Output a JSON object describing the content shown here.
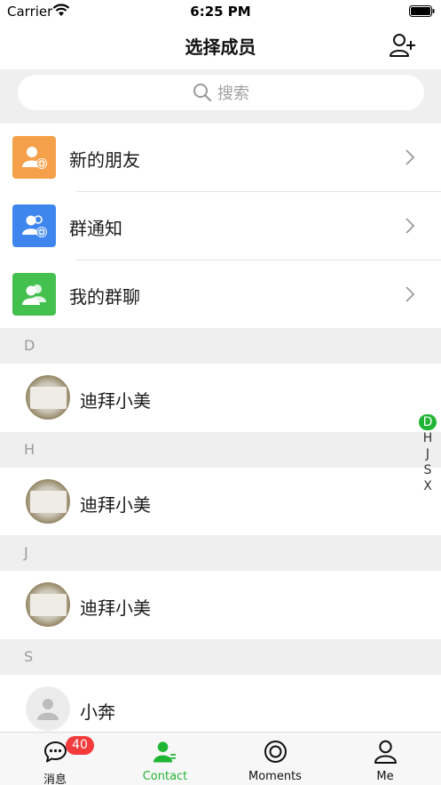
{
  "status_bar": {
    "carrier": "Carrier",
    "time": "6:25 PM"
  },
  "nav": {
    "title": "选择成员",
    "add_icon": "add-user-icon"
  },
  "search": {
    "placeholder": "搜索"
  },
  "entries": [
    {
      "label": "新的朋友",
      "icon": "new-friend-icon",
      "color": "#f5a04a"
    },
    {
      "label": "群通知",
      "icon": "group-notice-icon",
      "color": "#3e86ee"
    },
    {
      "label": "我的群聊",
      "icon": "my-groups-icon",
      "color": "#44c04f"
    }
  ],
  "sections": [
    {
      "letter": "D",
      "contacts": [
        {
          "name": "迪拜小美",
          "avatar": "photo"
        }
      ]
    },
    {
      "letter": "H",
      "contacts": [
        {
          "name": "迪拜小美",
          "avatar": "photo"
        }
      ]
    },
    {
      "letter": "J",
      "contacts": [
        {
          "name": "迪拜小美",
          "avatar": "photo"
        }
      ]
    },
    {
      "letter": "S",
      "contacts": [
        {
          "name": "小奔",
          "avatar": "default"
        }
      ]
    }
  ],
  "index": [
    "D",
    "H",
    "J",
    "S",
    "X"
  ],
  "index_active": "D",
  "tabs": [
    {
      "label": "消息",
      "icon": "chat-bubble-icon",
      "badge": "40"
    },
    {
      "label": "Contact",
      "icon": "contact-icon",
      "active": true
    },
    {
      "label": "Moments",
      "icon": "moments-icon"
    },
    {
      "label": "Me",
      "icon": "profile-icon"
    }
  ],
  "colors": {
    "accent": "#21b535",
    "badge": "#f33b3b",
    "section_bg": "#efefef"
  }
}
